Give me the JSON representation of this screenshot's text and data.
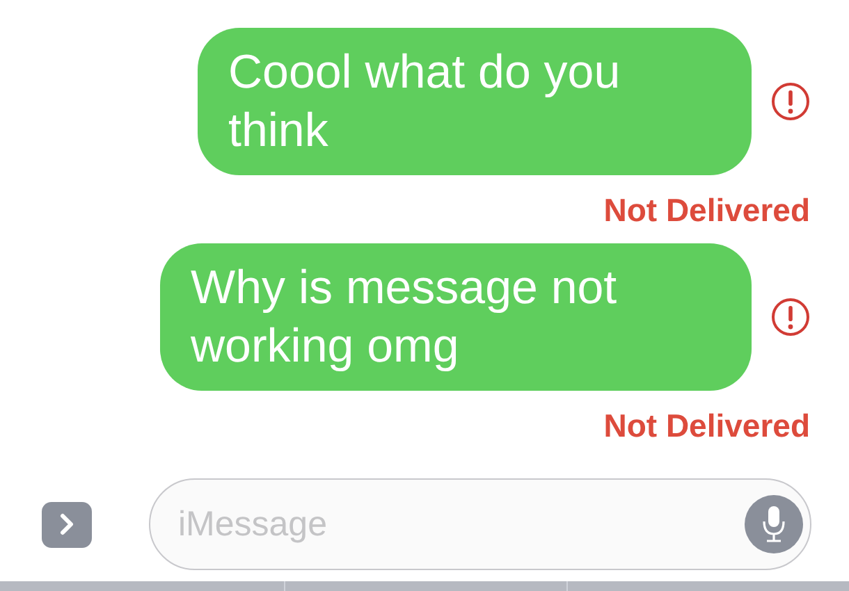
{
  "messages": [
    {
      "text": "Coool what do you think",
      "failed": true,
      "status": "Not Delivered"
    },
    {
      "text": "Why is message not working omg",
      "failed": true,
      "status": "Not Delivered"
    }
  ],
  "composer": {
    "placeholder": "iMessage"
  }
}
